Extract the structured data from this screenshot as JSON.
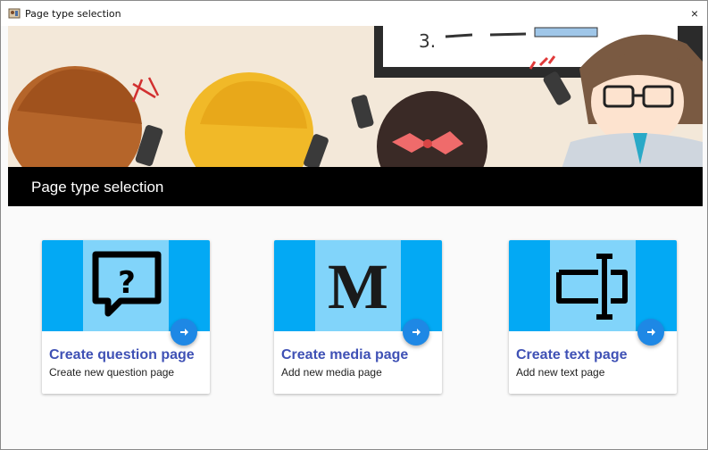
{
  "window": {
    "title": "Page type selection",
    "close_glyph": "×"
  },
  "header": {
    "title": "Page type selection"
  },
  "colors": {
    "header_bg": "#000000",
    "card_media_primary": "#03a9f4",
    "card_media_inner": "#81d4fa",
    "fab": "#1e88e5",
    "card_title": "#3f51b5"
  },
  "cards": [
    {
      "icon": "question-bubble-icon",
      "title": "Create question page",
      "subtitle": "Create new question page"
    },
    {
      "icon": "medium-m-icon",
      "title": "Create media page",
      "subtitle": "Add new media page",
      "glyph": "M"
    },
    {
      "icon": "text-cursor-icon",
      "title": "Create text page",
      "subtitle": "Add new text page"
    }
  ],
  "banner": {
    "icon": "classroom-illustration",
    "board_text": "3."
  }
}
